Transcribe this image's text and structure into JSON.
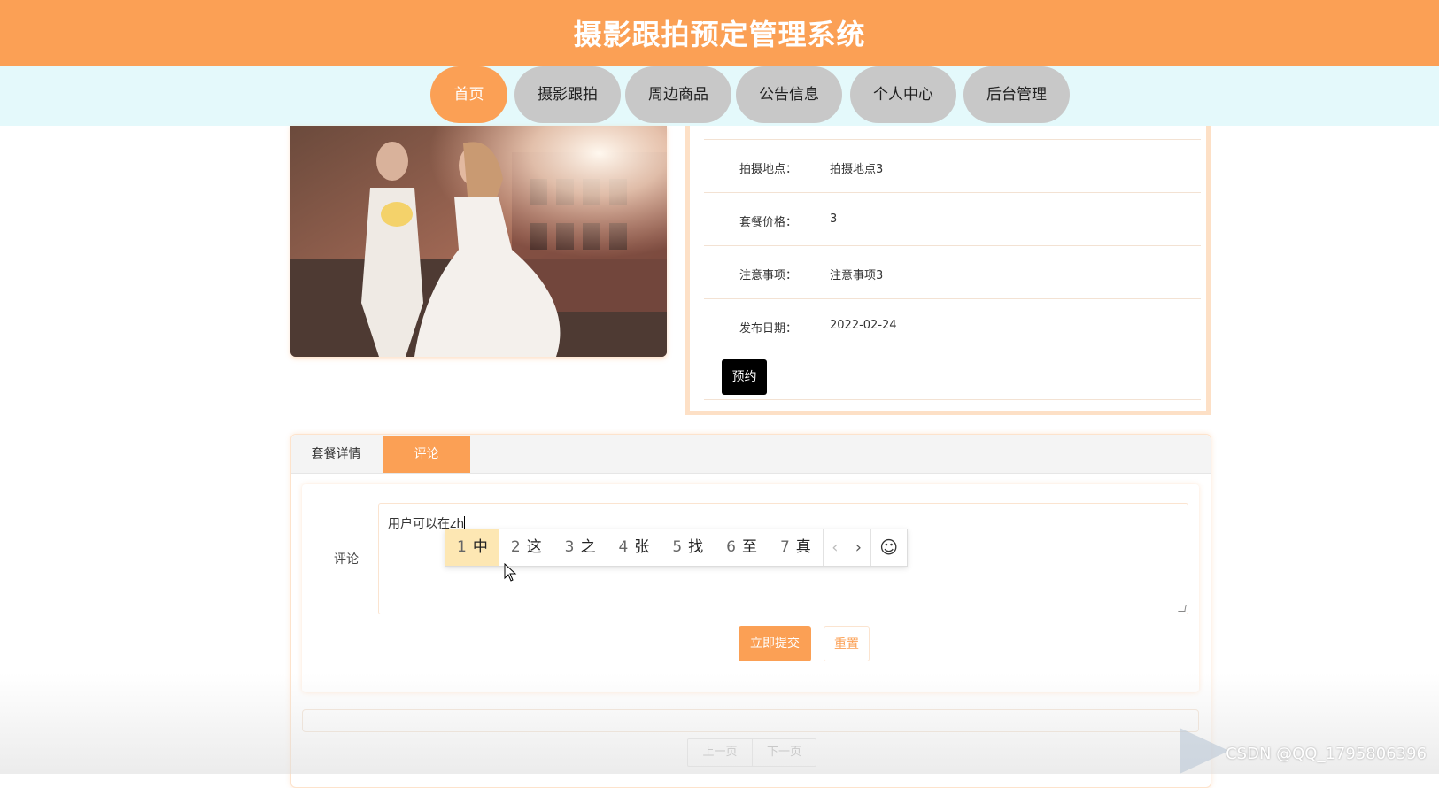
{
  "header": {
    "title": "摄影跟拍预定管理系统"
  },
  "nav": {
    "items": [
      {
        "label": "首页",
        "active": true
      },
      {
        "label": "摄影跟拍",
        "active": false
      },
      {
        "label": "周边商品",
        "active": false
      },
      {
        "label": "公告信息",
        "active": false
      },
      {
        "label": "个人中心",
        "active": false
      },
      {
        "label": "后台管理",
        "active": false
      }
    ]
  },
  "details": {
    "rows": [
      {
        "label": "拍摄地点：",
        "value": "拍摄地点3"
      },
      {
        "label": "套餐价格：",
        "value": "3"
      },
      {
        "label": "注意事项：",
        "value": "注意事项3"
      },
      {
        "label": "发布日期：",
        "value": "2022-02-24"
      }
    ],
    "reserve_label": "预约"
  },
  "tabs": [
    {
      "label": "套餐详情",
      "active": false
    },
    {
      "label": "评论",
      "active": true
    }
  ],
  "comment": {
    "label": "评论",
    "text": "用户可以在zh",
    "submit_label": "立即提交",
    "reset_label": "重置"
  },
  "ime": {
    "candidates": [
      {
        "num": "1",
        "char": "中"
      },
      {
        "num": "2",
        "char": "这"
      },
      {
        "num": "3",
        "char": "之"
      },
      {
        "num": "4",
        "char": "张"
      },
      {
        "num": "5",
        "char": "找"
      },
      {
        "num": "6",
        "char": "至"
      },
      {
        "num": "7",
        "char": "真"
      }
    ],
    "prev_icon": "chevron-left-icon",
    "next_icon": "chevron-right-icon",
    "emoji_icon": "smiley-icon"
  },
  "pager": {
    "prev_label": "上一页",
    "next_label": "下一页"
  },
  "watermark": {
    "text": "CSDN @QQ_1795806396"
  },
  "colors": {
    "accent": "#fba055",
    "nav_bg": "#e4f9fb",
    "nav_pill": "#c8c8c8",
    "ime_highlight": "#fde7b3"
  }
}
